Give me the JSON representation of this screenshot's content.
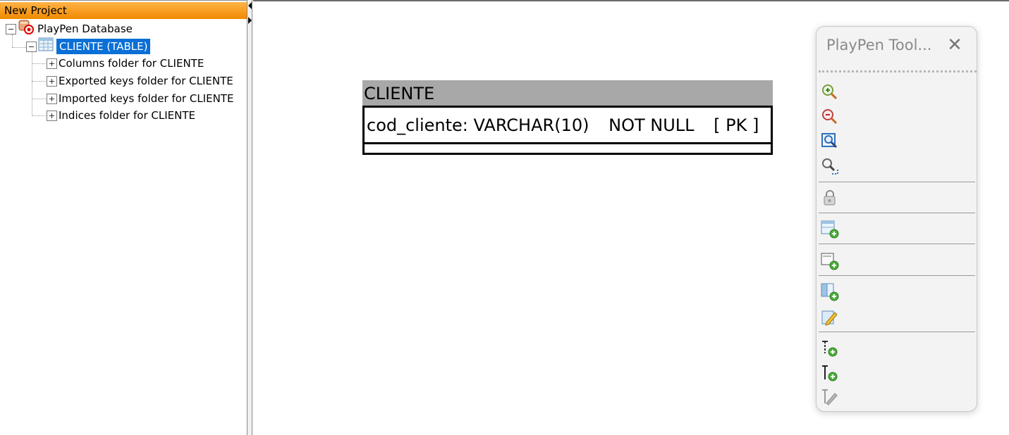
{
  "project": {
    "title": "New Project",
    "tree": {
      "root": "PlayPen Database",
      "table": "CLIENTE (TABLE)",
      "folders": [
        "Columns folder for CLIENTE",
        "Exported keys folder for CLIENTE",
        "Imported keys folder for CLIENTE",
        "Indices folder for CLIENTE"
      ]
    }
  },
  "playpen": {
    "table": {
      "name": "CLIENTE",
      "column": {
        "definition": "cod_cliente: VARCHAR(10)",
        "nullability": "NOT NULL",
        "key": "[ PK ]"
      }
    }
  },
  "toolbox": {
    "title": "PlayPen Tool...",
    "close_glyph": "✕",
    "tools": [
      {
        "icon": "zoom-in-icon"
      },
      {
        "icon": "zoom-out-icon"
      },
      {
        "icon": "zoom-to-fit-icon"
      },
      {
        "icon": "zoom-selection-icon"
      },
      {
        "icon": "lock-icon"
      },
      {
        "icon": "new-table-icon"
      },
      {
        "icon": "new-folder-icon"
      },
      {
        "icon": "insert-column-icon"
      },
      {
        "icon": "edit-icon"
      },
      {
        "icon": "identifying-relationship-icon"
      },
      {
        "icon": "non-identifying-relationship-icon"
      },
      {
        "icon": "edit-relationship-icon"
      }
    ]
  },
  "colors": {
    "header_orange": "#f08a00",
    "selection_blue": "#0a6fd6",
    "table_header_gray": "#a8a8a8"
  }
}
